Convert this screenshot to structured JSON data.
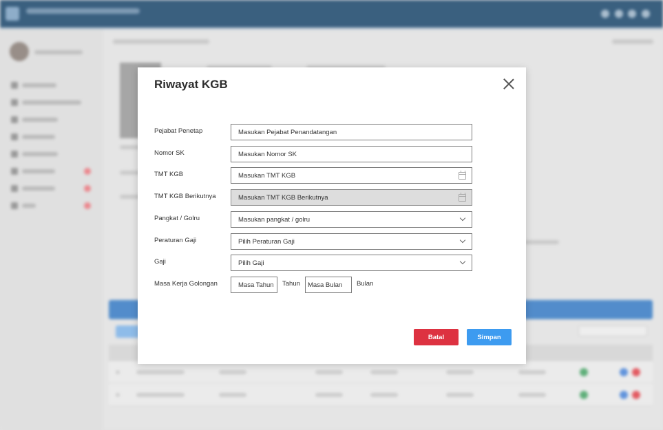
{
  "modal": {
    "title": "Riwayat KGB",
    "fields": [
      {
        "label": "Pejabat Penetap",
        "placeholder": "Masukan Pejabat Penandatangan",
        "type": "text"
      },
      {
        "label": "Nomor SK",
        "placeholder": "Masukan Nomor SK",
        "type": "text"
      },
      {
        "label": "TMT KGB",
        "placeholder": "Masukan TMT KGB",
        "type": "date"
      },
      {
        "label": "TMT KGB Berikutnya",
        "placeholder": "Masukan TMT KGB Berikutnya",
        "type": "date",
        "disabled": true
      },
      {
        "label": "Pangkat / Golru",
        "placeholder": "Masukan pangkat / golru",
        "type": "select"
      },
      {
        "label": "Peraturan Gaji",
        "placeholder": "Pilih Peraturan Gaji",
        "type": "select"
      },
      {
        "label": "Gaji",
        "placeholder": "Pilih Gaji",
        "type": "select"
      }
    ],
    "masa_kerja": {
      "label": "Masa Kerja Golongan",
      "tahun_placeholder": "Masa Tahun",
      "tahun_unit": "Tahun",
      "bulan_placeholder": "Masa Bulan",
      "bulan_unit": "Bulan"
    },
    "buttons": {
      "cancel": "Batal",
      "save": "Simpan"
    }
  },
  "icons": {
    "close": "close-icon",
    "calendar": "calendar-icon",
    "dropdown": "chevron-down-icon"
  },
  "colors": {
    "header": "#1f4a6e",
    "cancel": "#dd3241",
    "save": "#3d9bf0",
    "disabled_field": "#dddddd"
  }
}
